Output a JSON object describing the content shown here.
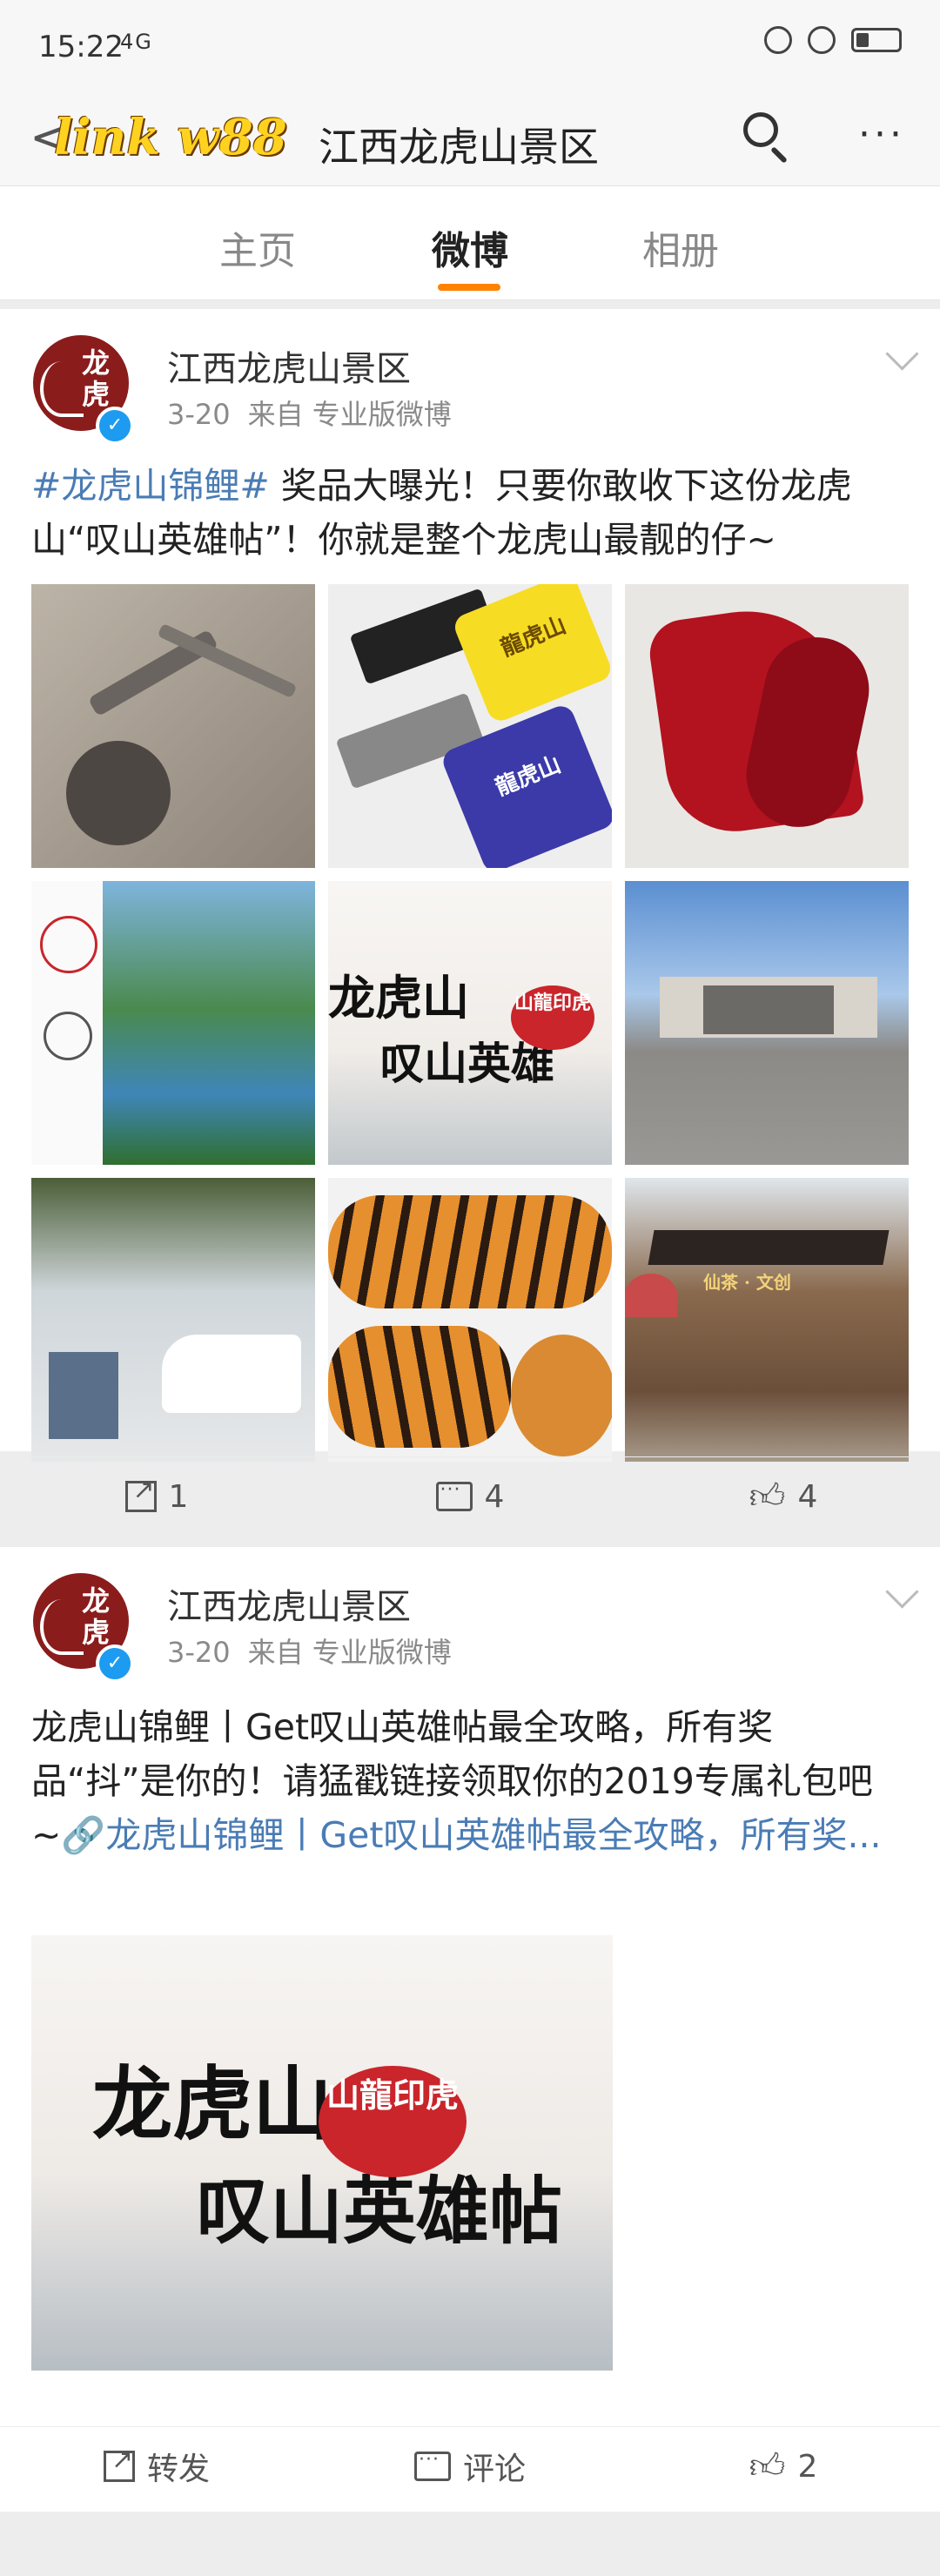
{
  "status_bar": {
    "time": "15:22",
    "signal": "4G"
  },
  "nav": {
    "back_label": "<",
    "overlay_text": "link w88",
    "title": "江西龙虎山景区",
    "more_label": "···"
  },
  "tabs": [
    {
      "label": "主页"
    },
    {
      "label": "微博"
    },
    {
      "label": "相册"
    }
  ],
  "avatar_text": "龙虎",
  "posts": [
    {
      "author": "江西龙虎山景区",
      "date": "3-20",
      "source": "来自 专业版微博",
      "hashtag": "#龙虎山锦鲤#",
      "text": " 奖品大曝光！只要你敢收下这份龙虎山“叹山英雄帖”！你就是整个龙虎山最靓的仔~",
      "image_texts": {
        "book_cover": "龍虎山",
        "phone_case": "龍虎山",
        "calligraphy_line1": "龙虎山",
        "calligraphy_line2": "叹山英雄",
        "seal": "山龍印虎",
        "hall_sign": "仙茶 · 文创"
      },
      "actions": {
        "repost": "1",
        "comment": "4",
        "like": "4"
      }
    },
    {
      "author": "江西龙虎山景区",
      "date": "3-20",
      "source": "来自 专业版微博",
      "text": "龙虎山锦鲤丨Get叹山英雄帖最全攻略，所有奖品“抖”是你的！请猛戳链接领取你的2019专属礼包吧~",
      "link_text": "🔗龙虎山锦鲤丨Get叹山英雄帖最全攻略，所有奖...",
      "image_texts": {
        "calligraphy_line1": "龙虎山",
        "calligraphy_line2": "叹山英雄帖",
        "seal": "山龍印虎"
      },
      "actions": {
        "repost": "转发",
        "comment": "评论",
        "like": "2"
      }
    }
  ],
  "colors": {
    "accent": "#ff8200",
    "link": "#4a7cb5",
    "verified": "#1d9bf0",
    "avatar_bg": "#8b1c1c"
  }
}
